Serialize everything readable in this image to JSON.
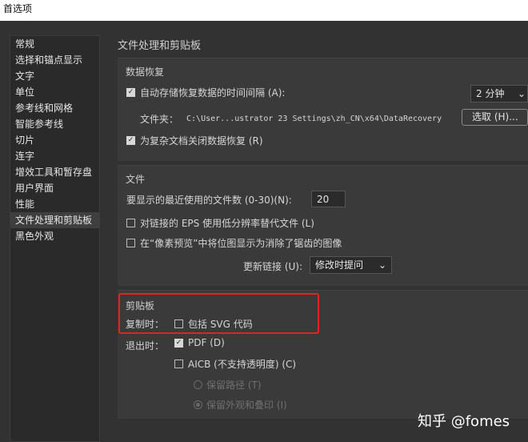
{
  "window": {
    "title": "首选项"
  },
  "sidebar": {
    "items": [
      {
        "label": "常规",
        "active": false
      },
      {
        "label": "选择和锚点显示",
        "active": false
      },
      {
        "label": "文字",
        "active": false
      },
      {
        "label": "单位",
        "active": false
      },
      {
        "label": "参考线和网格",
        "active": false
      },
      {
        "label": "智能参考线",
        "active": false
      },
      {
        "label": "切片",
        "active": false
      },
      {
        "label": "连字",
        "active": false
      },
      {
        "label": "增效工具和暂存盘",
        "active": false
      },
      {
        "label": "用户界面",
        "active": false
      },
      {
        "label": "性能",
        "active": false
      },
      {
        "label": "文件处理和剪贴板",
        "active": true
      },
      {
        "label": "黑色外观",
        "active": false
      }
    ]
  },
  "page_title": "文件处理和剪贴板",
  "data_recovery": {
    "title": "数据恢复",
    "autosave_label": "自动存储恢复数据的时间间隔 (A):",
    "autosave_checked": true,
    "interval_value": "2 分钟",
    "folder_label": "文件夹：",
    "folder_path": "C:\\User...ustrator 23 Settings\\zh_CN\\x64\\DataRecovery",
    "choose_button": "选取 (H)...",
    "disable_complex_label": "为复杂文档关闭数据恢复 (R)",
    "disable_complex_checked": true
  },
  "files": {
    "title": "文件",
    "recent_label": "要显示的最近使用的文件数 (0-30)(N):",
    "recent_value": "20",
    "eps_label": "对链接的 EPS 使用低分辨率替代文件 (L)",
    "eps_checked": false,
    "pixel_preview_label": "在“像素预览”中将位图显示为消除了锯齿的图像",
    "pixel_preview_checked": false,
    "update_links_label": "更新链接 (U):",
    "update_links_value": "修改时提问"
  },
  "clipboard": {
    "title": "剪贴板",
    "copy_label": "复制时：",
    "include_svg_label": "包括 SVG 代码",
    "include_svg_checked": false,
    "exit_label": "退出时：",
    "pdf_label": "PDF (D)",
    "pdf_checked": true,
    "aicb_label": "AICB (不支持透明度) (C)",
    "aicb_checked": false,
    "preserve_paths_label": "保留路径 (T)",
    "preserve_paths_selected": false,
    "preserve_appearance_label": "保留外观和叠印 (I)",
    "preserve_appearance_selected": true
  },
  "watermark": "知乎 @fomes",
  "colors": {
    "highlight_border": "#e02424",
    "background": "#323232",
    "panel": "#3a3a3a"
  }
}
